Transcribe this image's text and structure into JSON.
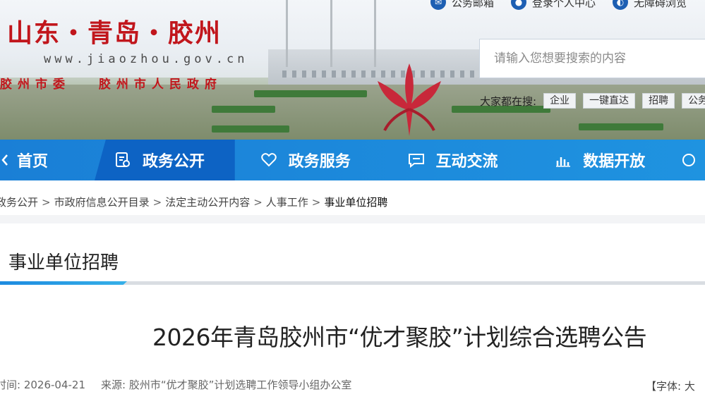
{
  "header": {
    "logo_title": "山东・青岛・胶州",
    "logo_url": "www.jiaozhou.gov.cn",
    "logo_sub": [
      "胶州市委",
      "胶州市人民政府"
    ],
    "top_links": [
      {
        "label": "公务邮箱",
        "icon": "mail-icon"
      },
      {
        "label": "登录个人中心",
        "icon": "user-icon"
      },
      {
        "label": "无障碍浏览",
        "icon": "accessibility-icon"
      }
    ],
    "search_placeholder": "请输入您想要搜索的内容",
    "hot_label": "大家都在搜:",
    "hot_tags": [
      "企业",
      "一键直达",
      "招聘",
      "公务"
    ]
  },
  "nav": {
    "items": [
      {
        "label": "首页",
        "icon": "home-icon"
      },
      {
        "label": "政务公开",
        "icon": "document-icon"
      },
      {
        "label": "政务服务",
        "icon": "heart-icon"
      },
      {
        "label": "互动交流",
        "icon": "chat-icon"
      },
      {
        "label": "数据开放",
        "icon": "bar-chart-icon"
      },
      {
        "label": "",
        "icon": "more-icon"
      }
    ],
    "active_index": 1
  },
  "breadcrumb": [
    "政务公开",
    "市政府信息公开目录",
    "法定主动公开内容",
    "人事工作",
    "事业单位招聘"
  ],
  "section": {
    "title": "事业单位招聘"
  },
  "article": {
    "title": "2026年青岛胶州市“优才聚胶”计划综合选聘公告",
    "time_label": "时间:",
    "time_value": "2026-04-21",
    "source_label": "来源:",
    "source_value": "胶州市“优才聚胶”计划选聘工作领导小组办公室",
    "font_label": "【字体:",
    "font_option": "大"
  },
  "colors": {
    "nav_bg": "#1a7fd6",
    "nav_active": "#0d63c4",
    "brand_red": "#c1161c"
  }
}
